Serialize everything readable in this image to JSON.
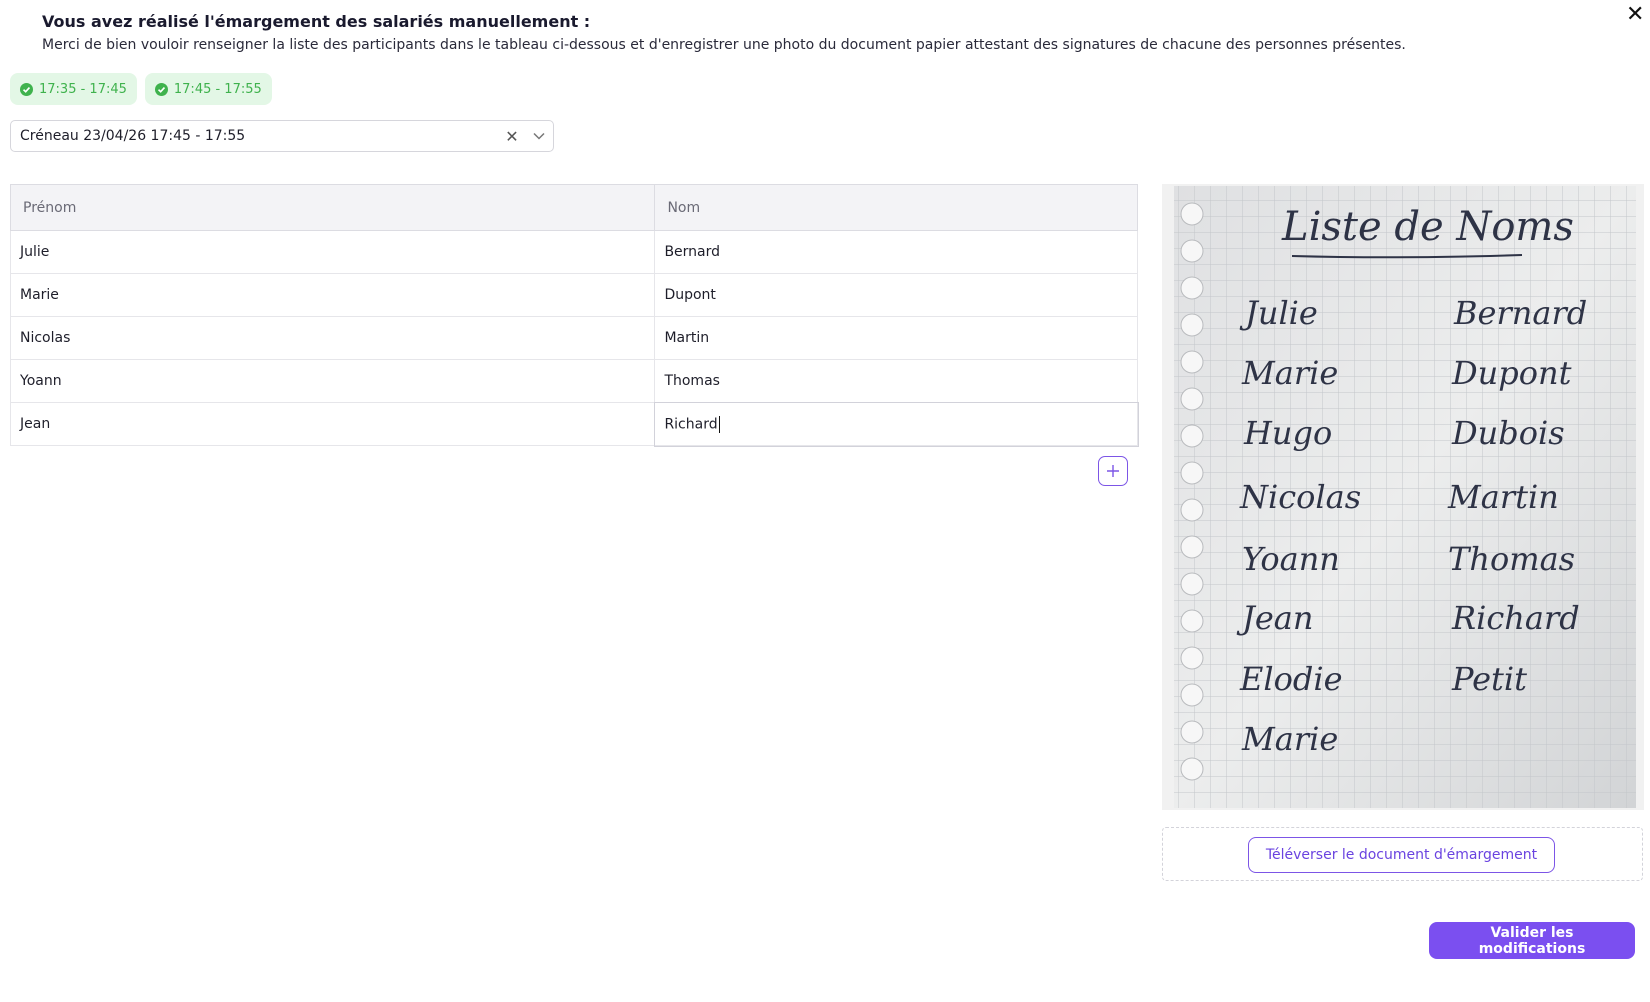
{
  "header": {
    "title": "Vous avez réalisé l'émargement des salariés manuellement :",
    "subtitle": "Merci de bien vouloir renseigner la liste des participants dans le tableau ci-dessous et d'enregistrer une photo du document papier attestant des signatures de chacune des personnes présentes.",
    "close_label": "✕"
  },
  "slots": [
    {
      "label": "17:35 - 17:45"
    },
    {
      "label": "17:45 - 17:55"
    }
  ],
  "slot_select": {
    "value": "Créneau 23/04/26 17:45 - 17:55",
    "clear_label": "✕"
  },
  "table": {
    "headers": [
      "Prénom",
      "Nom"
    ],
    "rows": [
      {
        "prenom": "Julie",
        "nom": "Bernard"
      },
      {
        "prenom": "Marie",
        "nom": "Dupont"
      },
      {
        "prenom": "Nicolas",
        "nom": "Martin"
      },
      {
        "prenom": "Yoann",
        "nom": "Thomas"
      },
      {
        "prenom": "Jean",
        "nom": "Richard"
      }
    ]
  },
  "document": {
    "title": "Liste de Noms",
    "lines": [
      {
        "first": "Julie",
        "last": "Bernard"
      },
      {
        "first": "Marie",
        "last": "Dupont"
      },
      {
        "first": "Hugo",
        "last": "Dubois"
      },
      {
        "first": "Nicolas",
        "last": "Martin"
      },
      {
        "first": "Yoann",
        "last": "Thomas"
      },
      {
        "first": "Jean",
        "last": "Richard"
      },
      {
        "first": "Elodie",
        "last": "Petit"
      },
      {
        "first": "Marie",
        "last": ""
      }
    ]
  },
  "actions": {
    "upload_label": "Téléverser le document d'émargement",
    "validate_label": "Valider les modifications"
  },
  "colors": {
    "accent": "#7b4ff0",
    "chip_bg": "#e3f7e6",
    "chip_text": "#3fb24d"
  }
}
